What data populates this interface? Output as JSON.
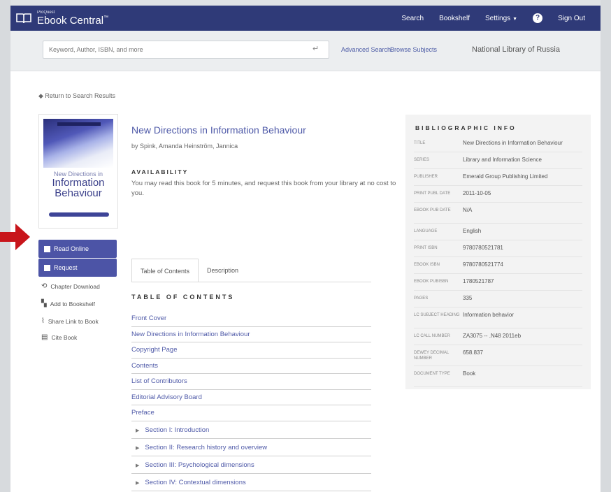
{
  "header": {
    "brand_small": "ProQuest",
    "brand_big": "Ebook Central",
    "brand_tm": "™",
    "nav": {
      "search": "Search",
      "bookshelf": "Bookshelf",
      "settings": "Settings",
      "help": "?",
      "signout": "Sign Out"
    }
  },
  "search": {
    "placeholder": "Keyword, Author, ISBN, and more",
    "advanced": "Advanced Search",
    "browse": "Browse Subjects",
    "library": "National Library of Russia"
  },
  "page": {
    "back": "Return to Search Results",
    "title": "New Directions in Information Behaviour",
    "authors": "by Spink, Amanda Heinström, Jannica",
    "availability_label": "AVAILABILITY",
    "availability_text": "You may read this book for 5 minutes, and request this book from your library at no cost to you."
  },
  "cover": {
    "subtitle": "New Directions in",
    "title_line1": "Information",
    "title_line2": "Behaviour"
  },
  "sidebar": {
    "read_online": "Read Online",
    "request": "Request",
    "chapter_download": "Chapter Download",
    "add_to_bookshelf": "Add to Bookshelf",
    "share_link": "Share Link to Book",
    "cite_book": "Cite Book"
  },
  "tabs": [
    "Table of Contents",
    "Description"
  ],
  "toc": {
    "heading": "TABLE OF CONTENTS",
    "items": [
      "Front Cover",
      "New Directions in Information Behaviour",
      "Copyright Page",
      "Contents",
      "List of Contributors",
      "Editorial Advisory Board",
      "Preface"
    ],
    "sections": [
      "Section I: Introduction",
      "Section II: Research history and overview",
      "Section III: Psychological dimensions",
      "Section IV: Contextual dimensions"
    ]
  },
  "biblio": {
    "heading": "BIBLIOGRAPHIC INFO",
    "rows": [
      {
        "k": "Title",
        "v": "New Directions in Information Behaviour"
      },
      {
        "k": "Series",
        "v": "Library and Information Science"
      },
      {
        "k": "Publisher",
        "v": "Emerald Group Publishing Limited"
      },
      {
        "k": "Print Publ Date",
        "v": "2011-10-05"
      },
      {
        "k": "Ebook Pub Date",
        "v": "N/A"
      },
      {
        "k": "Language",
        "v": "English"
      },
      {
        "k": "Print ISBN",
        "v": "9780780521781"
      },
      {
        "k": "Ebook ISBN",
        "v": "9780780521774"
      },
      {
        "k": "Ebook PubISBN",
        "v": "1780521787"
      },
      {
        "k": "Pages",
        "v": "335"
      },
      {
        "k": "LC Subject Heading",
        "v": "Information behavior"
      },
      {
        "k": "LC Call Number",
        "v": "ZA3075 -- .N48 2011eb"
      },
      {
        "k": "Dewey Decimal Number",
        "v": "658.837"
      },
      {
        "k": "Document Type",
        "v": "Book"
      }
    ]
  },
  "colors": {
    "header_bg": "#2f3a78",
    "accent": "#4c54a6",
    "link": "#4f5aa8",
    "arrow": "#c8151b"
  }
}
